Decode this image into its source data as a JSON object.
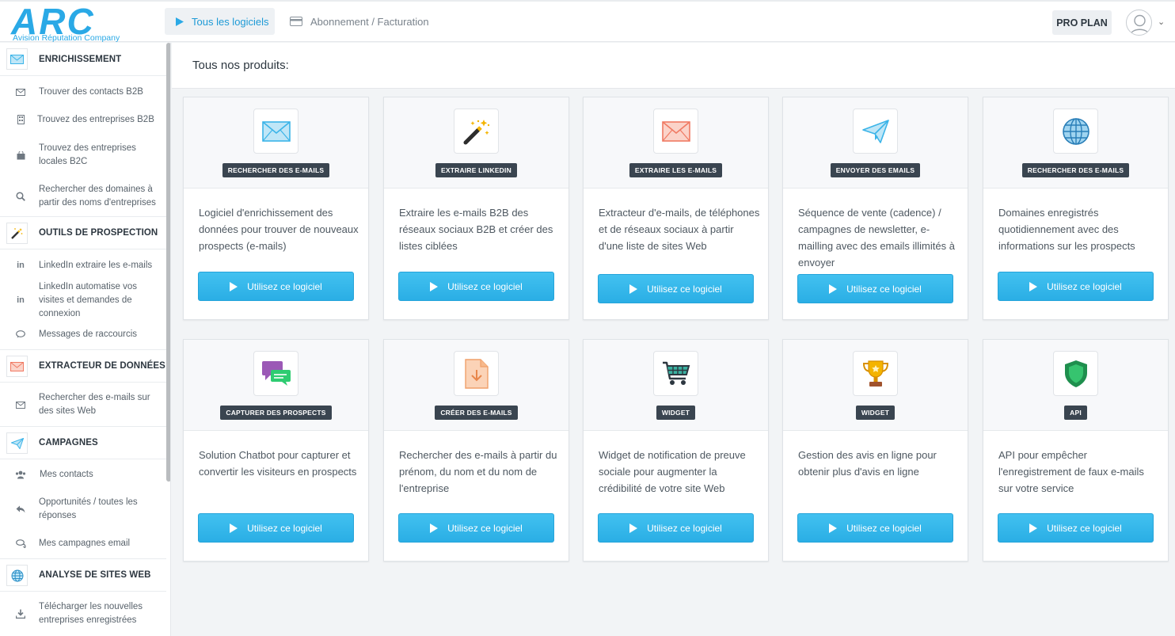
{
  "brand": {
    "letters": "ARC",
    "tagline": "Avision Réputation Company",
    "color": "#2aa9e6"
  },
  "topnav": {
    "tabs": [
      {
        "label": "Tous les logiciels",
        "active": true,
        "icon": "play-icon"
      },
      {
        "label": "Abonnement / Facturation",
        "active": false,
        "icon": "credit-card-icon"
      }
    ],
    "plan_label": "PRO PLAN"
  },
  "sidebar": {
    "sections": [
      {
        "label": "ENRICHISSEMENT",
        "icon": "envelope-icon",
        "items": [
          {
            "label": "Trouver des contacts B2B",
            "icon": "envelope-icon"
          },
          {
            "label": "Trouvez des entreprises B2B",
            "icon": "building-icon"
          },
          {
            "label": "Trouvez des entreprises locales B2C",
            "icon": "shopping-bag-icon"
          },
          {
            "label": "Rechercher des domaines à partir des noms d'entreprises",
            "icon": "search-icon"
          }
        ]
      },
      {
        "label": "OUTILS DE PROSPECTION",
        "icon": "magic-wand-icon",
        "items": [
          {
            "label": "LinkedIn extraire les e-mails",
            "icon": "linkedin-icon"
          },
          {
            "label": "LinkedIn automatise vos visites et demandes de connexion",
            "icon": "linkedin-icon"
          },
          {
            "label": "Messages de raccourcis",
            "icon": "chat-icon"
          }
        ]
      },
      {
        "label": "EXTRACTEUR DE DONNÉES",
        "icon": "envelope-red-icon",
        "items": [
          {
            "label": "Rechercher des e-mails sur des sites Web",
            "icon": "envelope-icon"
          }
        ]
      },
      {
        "label": "CAMPAGNES",
        "icon": "paper-plane-icon",
        "items": [
          {
            "label": "Mes contacts",
            "icon": "users-icon"
          },
          {
            "label": "Opportunités / toutes les réponses",
            "icon": "reply-icon"
          },
          {
            "label": "Mes campagnes email",
            "icon": "comments-icon"
          }
        ]
      },
      {
        "label": "ANALYSE DE SITES WEB",
        "icon": "globe-icon",
        "items": [
          {
            "label": "Télécharger les nouvelles entreprises enregistrées",
            "icon": "download-icon"
          }
        ]
      }
    ]
  },
  "main": {
    "title": "Tous nos produits:",
    "button_label": "Utilisez ce logiciel",
    "cards": [
      {
        "tag": "RECHERCHER DES E-MAILS",
        "icon": "envelope-icon",
        "description": "Logiciel d'enrichissement des données pour trouver de nouveaux prospects (e-mails)"
      },
      {
        "tag": "EXTRAIRE LINKEDIN",
        "icon": "magic-wand-icon",
        "description": "Extraire les e-mails B2B des réseaux sociaux B2B et créer des listes ciblées"
      },
      {
        "tag": "EXTRAIRE LES E-MAILS",
        "icon": "envelope-red-icon",
        "description": "Extracteur d'e-mails, de téléphones et de réseaux sociaux à partir d'une liste de sites Web"
      },
      {
        "tag": "ENVOYER DES EMAILS",
        "icon": "paper-plane-icon",
        "description": "Séquence de vente (cadence) / campagnes de newsletter, e-mailling avec des emails illimités à envoyer"
      },
      {
        "tag": "RECHERCHER DES E-MAILS",
        "icon": "globe-icon",
        "description": "Domaines enregistrés quotidiennement avec des informations sur les prospects"
      },
      {
        "tag": "CAPTURER DES PROSPECTS",
        "icon": "chat-bubbles-icon",
        "description": "Solution Chatbot pour capturer et convertir les visiteurs en prospects"
      },
      {
        "tag": "CRÉER DES E-MAILS",
        "icon": "file-download-icon",
        "description": "Rechercher des e-mails à partir du prénom, du nom et du nom de l'entreprise"
      },
      {
        "tag": "WIDGET",
        "icon": "shopping-cart-icon",
        "description": "Widget de notification de preuve sociale pour augmenter la crédibilité de votre site Web"
      },
      {
        "tag": "WIDGET",
        "icon": "trophy-icon",
        "description": "Gestion des avis en ligne pour obtenir plus d'avis en ligne"
      },
      {
        "tag": "API",
        "icon": "shield-icon",
        "description": "API pour empêcher l'enregistrement de faux e-mails sur votre service"
      }
    ]
  }
}
